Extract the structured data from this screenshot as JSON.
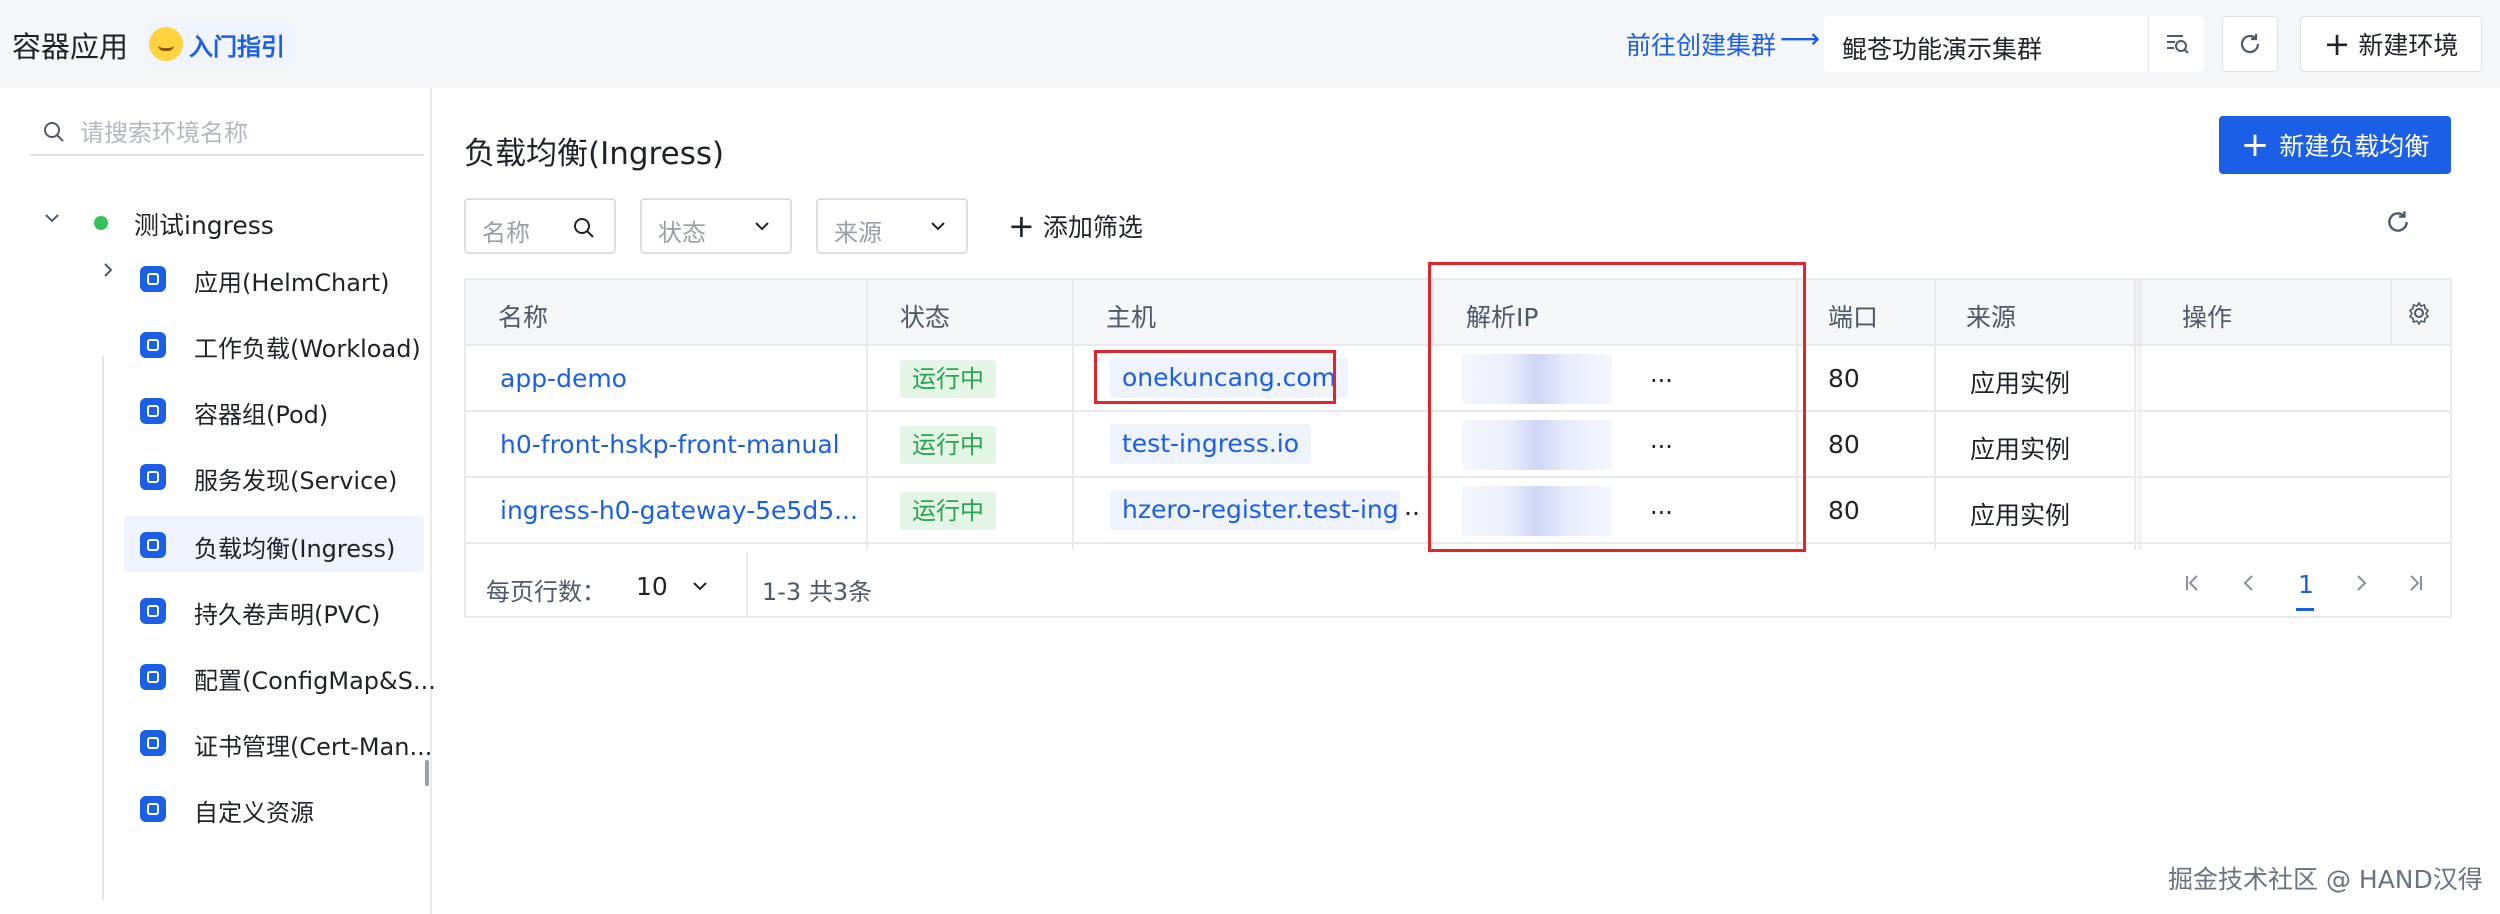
{
  "header": {
    "app_title": "容器应用",
    "guide_label": "入门指引",
    "goto_cluster_link": "前往创建集群",
    "goto_arrow": "⟶",
    "cluster_value": "鲲苍功能演示集群",
    "new_env_label": "新建环境",
    "plus": "+"
  },
  "sidebar": {
    "search_placeholder": "请搜索环境名称",
    "env_name": "测试ingress",
    "items": [
      {
        "label": "应用(HelmChart)"
      },
      {
        "label": "工作负载(Workload)"
      },
      {
        "label": "容器组(Pod)"
      },
      {
        "label": "服务发现(Service)"
      },
      {
        "label": "负载均衡(Ingress)"
      },
      {
        "label": "持久卷声明(PVC)"
      },
      {
        "label": "配置(ConfigMap&S..."
      },
      {
        "label": "证书管理(Cert-Man..."
      },
      {
        "label": "自定义资源"
      }
    ]
  },
  "main": {
    "title": "负载均衡(Ingress)",
    "new_button": "新建负载均衡",
    "filters": {
      "name_placeholder": "名称",
      "status_placeholder": "状态",
      "source_placeholder": "来源",
      "add_filter": "添加筛选"
    },
    "table": {
      "headers": [
        "名称",
        "状态",
        "主机",
        "解析IP",
        "端口",
        "来源",
        "操作"
      ],
      "rows": [
        {
          "name": "app-demo",
          "status": "运行中",
          "host": "onekuncang.com",
          "ip_more": "...",
          "port": "80",
          "source": "应用实例"
        },
        {
          "name": "h0-front-hskp-front-manual",
          "status": "运行中",
          "host": "test-ingress.io",
          "ip_more": "...",
          "port": "80",
          "source": "应用实例"
        },
        {
          "name": "ingress-h0-gateway-5e5d5...",
          "status": "运行中",
          "host": "hzero-register.test-ingre",
          "host_more": "..",
          "ip_more": "...",
          "port": "80",
          "source": "应用实例"
        }
      ]
    },
    "pagination": {
      "rows_per_page_label": "每页行数：",
      "page_size": "10",
      "range": "1-3  共3条",
      "current_page": "1"
    }
  },
  "watermark": "掘金技术社区 @ HAND汉得",
  "colors": {
    "accent": "#1c5fe7",
    "success_bg": "#e3f6e6",
    "success_text": "#2aa44f",
    "highlight_red": "#e0262a"
  }
}
